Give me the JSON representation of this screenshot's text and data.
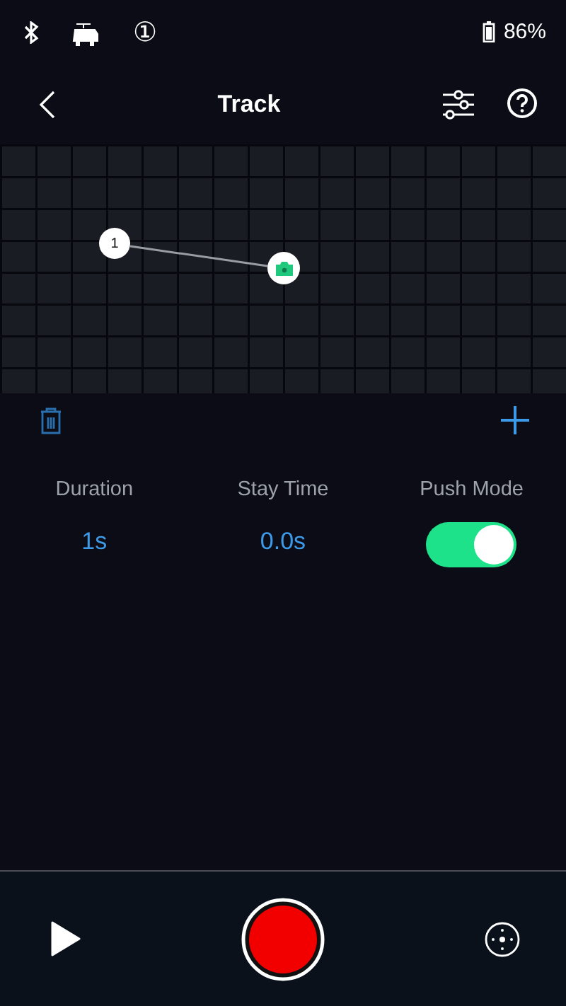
{
  "status_bar": {
    "indicator": "①",
    "battery": "86%"
  },
  "header": {
    "title": "Track"
  },
  "track": {
    "waypoints": [
      {
        "label": "1"
      }
    ]
  },
  "settings": [
    {
      "kind": "value",
      "label": "Duration",
      "value": "1s"
    },
    {
      "kind": "value",
      "label": "Stay Time",
      "value": "0.0s"
    },
    {
      "kind": "toggle",
      "label": "Push Mode",
      "on": true
    }
  ]
}
